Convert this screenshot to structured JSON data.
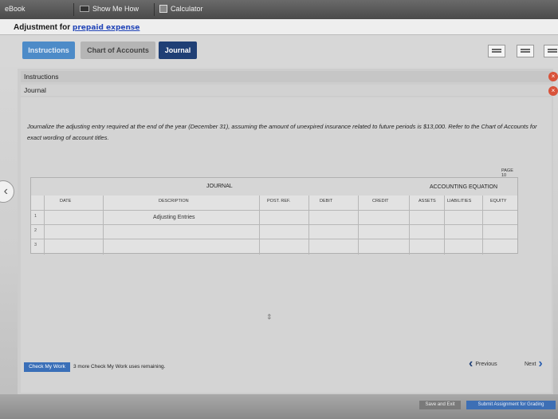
{
  "toolbar": {
    "ebook": "eBook",
    "show_me_how": "Show Me How",
    "calculator": "Calculator"
  },
  "header": {
    "title_prefix": "Adjustment for ",
    "title_link": "prepaid expense"
  },
  "tabs": [
    {
      "label": "Instructions"
    },
    {
      "label": "Chart of Accounts"
    },
    {
      "label": "Journal"
    }
  ],
  "panels": {
    "instructions": "Instructions",
    "journal": "Journal"
  },
  "instruction_text": "Journalize the adjusting entry required at the end of the year (December 31), assuming the amount of unexpired insurance related to future periods is $13,000. Refer to the Chart of Accounts for exact wording of account titles.",
  "journal": {
    "page": "PAGE 10",
    "title": "JOURNAL",
    "accounting_equation": "ACCOUNTING EQUATION",
    "columns": {
      "date": "DATE",
      "description": "DESCRIPTION",
      "post_ref": "POST. REF.",
      "debit": "DEBIT",
      "credit": "CREDIT",
      "assets": "ASSETS",
      "liabilities": "LIABILITIES",
      "equity": "EQUITY"
    },
    "subheading": "Adjusting Entries",
    "rows": [
      "1",
      "2",
      "3"
    ]
  },
  "bottom": {
    "check_my_work": "Check My Work",
    "remaining": "3 more Check My Work uses remaining.",
    "previous": "Previous",
    "next": "Next"
  },
  "footer": {
    "save_exit": "Save and Exit",
    "submit": "Submit Assignment for Grading"
  }
}
